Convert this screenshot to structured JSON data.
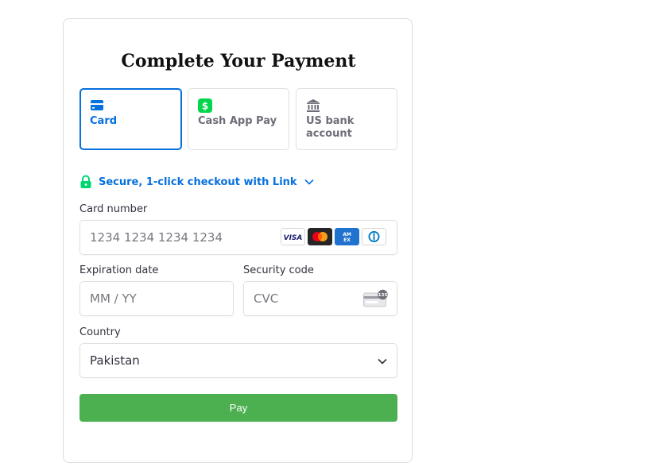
{
  "form": {
    "title": "Complete Your Payment",
    "tabs": [
      {
        "label": "Card",
        "icon": "credit-card-icon",
        "active": true
      },
      {
        "label": "Cash App Pay",
        "icon": "cash-app-icon",
        "active": false
      },
      {
        "label": "US bank account",
        "icon": "bank-icon",
        "active": false
      }
    ],
    "link": {
      "text": "Secure, 1-click checkout with Link",
      "icon": "lock-icon",
      "chevron": "chevron-down-icon"
    },
    "card_number": {
      "label": "Card number",
      "placeholder": "1234 1234 1234 1234",
      "brands": [
        "VISA",
        "Mastercard",
        "American Express",
        "Diners Club"
      ]
    },
    "expiry": {
      "label": "Expiration date",
      "placeholder": "MM / YY"
    },
    "cvc": {
      "label": "Security code",
      "placeholder": "CVC",
      "badge": "135"
    },
    "country": {
      "label": "Country",
      "value": "Pakistan"
    },
    "pay_label": "Pay"
  },
  "colors": {
    "accent": "#0570de",
    "pay_button": "#4caf50",
    "lock": "#00d66f",
    "cash_app": "#00d54b",
    "text": "#30313d",
    "placeholder": "#77787f"
  }
}
